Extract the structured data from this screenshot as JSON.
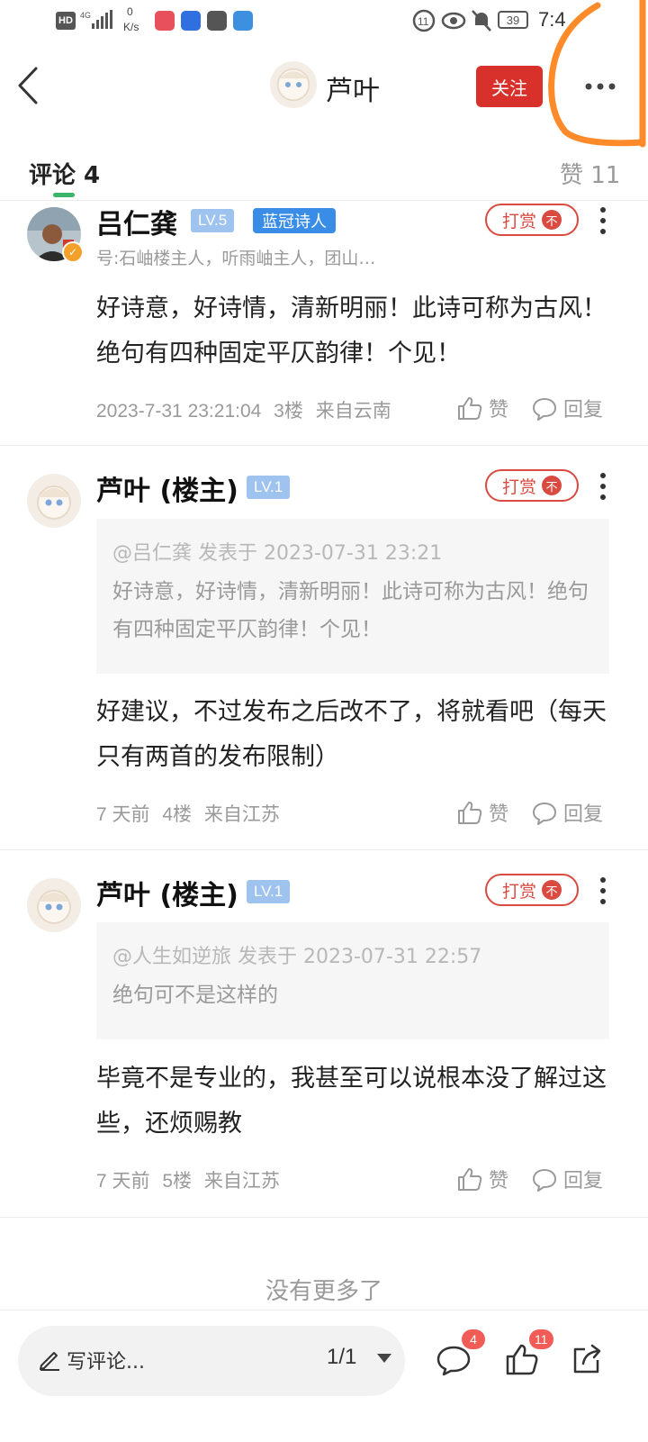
{
  "status_bar": {
    "hd": "HD",
    "net_speed_value": "0",
    "net_speed_unit": "K/s",
    "battery": "39",
    "time": "7:4"
  },
  "header": {
    "author_name": "芦叶",
    "follow_label": "关注"
  },
  "tabs": {
    "comments_label": "评论 4",
    "likes_label": "赞 11"
  },
  "comments": [
    {
      "name": "吕仁龚",
      "level": "LV.5",
      "badge": "蓝冠诗人",
      "subtitle": "号:石岫楼主人，听雨岫主人，团山…",
      "tip_label": "打赏",
      "tip_coin": "不",
      "body": "好诗意，好诗情，清新明丽！此诗可称为古风！绝句有四种固定平仄韵律！个见！",
      "time": "2023-7-31 23:21:04",
      "floor": "3楼",
      "location": "来自云南",
      "like_label": "赞",
      "reply_label": "回复"
    },
    {
      "name": "芦叶 (楼主)",
      "level": "LV.1",
      "tip_label": "打赏",
      "tip_coin": "不",
      "quote_head": "@吕仁龚 发表于 2023-07-31 23:21",
      "quote_body": "好诗意，好诗情，清新明丽！此诗可称为古风！绝句有四种固定平仄韵律！个见！",
      "body": "好建议，不过发布之后改不了，将就看吧（每天只有两首的发布限制）",
      "time": "7 天前",
      "floor": "4楼",
      "location": "来自江苏",
      "like_label": "赞",
      "reply_label": "回复"
    },
    {
      "name": "芦叶 (楼主)",
      "level": "LV.1",
      "tip_label": "打赏",
      "tip_coin": "不",
      "quote_head": "@人生如逆旅 发表于 2023-07-31 22:57",
      "quote_body": "绝句可不是这样的",
      "body": "毕竟不是专业的，我甚至可以说根本没了解过这些，还烦赐教",
      "time": "7 天前",
      "floor": "5楼",
      "location": "来自江苏",
      "like_label": "赞",
      "reply_label": "回复"
    }
  ],
  "end_text": "没有更多了",
  "bottom_bar": {
    "write_placeholder": "写评论...",
    "page_indicator": "1/1",
    "comment_count": "4",
    "like_count": "11"
  },
  "colors": {
    "accent_red": "#d8302b",
    "tab_green": "#3bb56a",
    "badge_blue": "#3a8de6",
    "level_blue": "#9fc3ef",
    "annotation_orange": "#ff8a2a"
  },
  "icons": [
    "back-arrow-icon",
    "more-dots-icon",
    "kebab-menu-icon",
    "thumbs-up-icon",
    "reply-bubble-icon",
    "pencil-icon",
    "dropdown-arrow-icon",
    "comment-icon",
    "share-icon"
  ]
}
